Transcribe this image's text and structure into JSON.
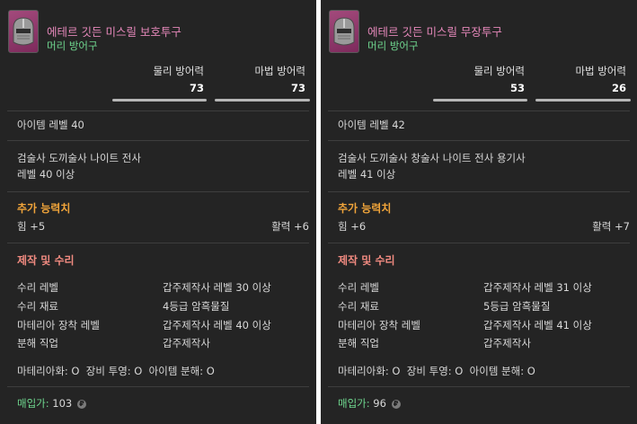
{
  "items": [
    {
      "name": "에테르 깃든 미스릴 보호투구",
      "type": "머리 방어구",
      "phys_def_label": "물리 방어력",
      "phys_def_value": "73",
      "mag_def_label": "마법 방어력",
      "mag_def_value": "73",
      "item_level": "아이템 레벨 40",
      "jobs": "검술사 도끼술사 나이트 전사",
      "level_req": "레벨 40 이상",
      "bonus_title": "추가 능력치",
      "bonus_left": "힘 +5",
      "bonus_right": "활력 +6",
      "craft_title": "제작 및 수리",
      "repair_level_label": "수리 레벨",
      "repair_level_value": "갑주제작사 레벨 30 이상",
      "repair_mat_label": "수리 재료",
      "repair_mat_value": "4등급 암흑물질",
      "materia_label": "마테리아 장착 레벨",
      "materia_value": "갑주제작사 레벨 40 이상",
      "desynth_label": "분해 직업",
      "desynth_value": "갑주제작사",
      "flags": "마테리아화: O  장비 투영: O  아이템 분해: O",
      "price_label": "매입가:",
      "price_value": "103",
      "currency_symbol": "₽"
    },
    {
      "name": "에테르 깃든 미스릴 무장투구",
      "type": "머리 방어구",
      "phys_def_label": "물리 방어력",
      "phys_def_value": "53",
      "mag_def_label": "마법 방어력",
      "mag_def_value": "26",
      "item_level": "아이템 레벨 42",
      "jobs": "검술사 도끼술사 창술사 나이트 전사 용기사",
      "level_req": "레벨 41 이상",
      "bonus_title": "추가 능력치",
      "bonus_left": "힘 +6",
      "bonus_right": "활력 +7",
      "craft_title": "제작 및 수리",
      "repair_level_label": "수리 레벨",
      "repair_level_value": "갑주제작사 레벨 31 이상",
      "repair_mat_label": "수리 재료",
      "repair_mat_value": "5등급 암흑물질",
      "materia_label": "마테리아 장착 레벨",
      "materia_value": "갑주제작사 레벨 41 이상",
      "desynth_label": "분해 직업",
      "desynth_value": "갑주제작사",
      "flags": "마테리아화: O  장비 투영: O  아이템 분해: O",
      "price_label": "매입가:",
      "price_value": "96",
      "currency_symbol": "₽"
    }
  ],
  "colors": {
    "panel_bg": "#242424",
    "item_name": "#e487b9",
    "green_text": "#6fd78f",
    "section_orange": "#f0a43a",
    "section_salmon": "#f08a80"
  },
  "icons": [
    "helmet-icon",
    "gil-icon"
  ]
}
